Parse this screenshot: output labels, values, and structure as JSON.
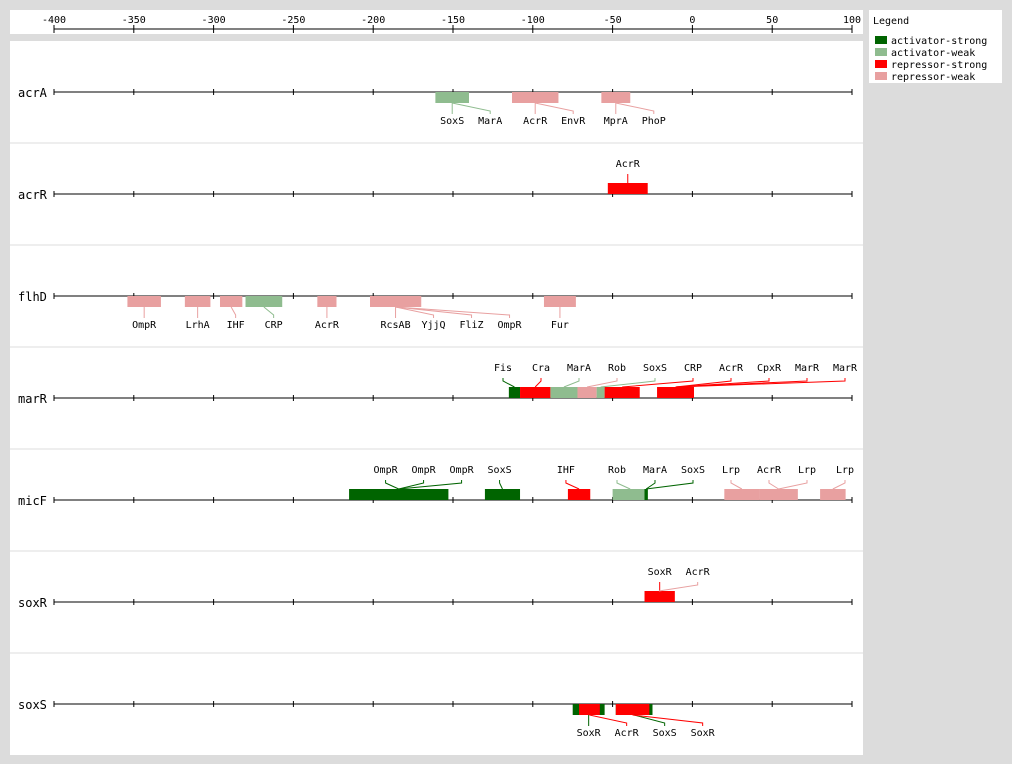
{
  "colors": {
    "activator-strong": "#006400",
    "activator-weak": "#8fbc8f",
    "repressor-strong": "#ff0000",
    "repressor-weak": "#e8a0a0"
  },
  "axis": {
    "min": -400,
    "max": 100,
    "ticks": [
      "-400",
      "-350",
      "-300",
      "-250",
      "-200",
      "-150",
      "-100",
      "-50",
      "0",
      "50",
      "100"
    ]
  },
  "legend": {
    "title": "Legend",
    "items": [
      {
        "key": "activator-strong",
        "label": "activator-strong"
      },
      {
        "key": "activator-weak",
        "label": "activator-weak"
      },
      {
        "key": "repressor-strong",
        "label": "repressor-strong"
      },
      {
        "key": "repressor-weak",
        "label": "repressor-weak"
      }
    ]
  },
  "chart_data": {
    "type": "diagram",
    "genes": [
      {
        "name": "acrA",
        "label_side": "below",
        "sites": [
          {
            "tf": "SoxS",
            "start": -161,
            "end": -140,
            "type": "activator-weak"
          },
          {
            "tf": "MarA",
            "start": -161,
            "end": -140,
            "type": "activator-weak"
          },
          {
            "tf": "AcrR",
            "start": -113,
            "end": -84,
            "type": "repressor-weak"
          },
          {
            "tf": "EnvR",
            "start": -113,
            "end": -84,
            "type": "repressor-weak"
          },
          {
            "tf": "MprA",
            "start": -57,
            "end": -39,
            "type": "repressor-weak"
          },
          {
            "tf": "PhoP",
            "start": -57,
            "end": -39,
            "type": "repressor-weak"
          }
        ]
      },
      {
        "name": "acrR",
        "label_side": "above",
        "sites": [
          {
            "tf": "AcrR",
            "start": -53,
            "end": -28,
            "type": "repressor-strong"
          }
        ]
      },
      {
        "name": "flhD",
        "label_side": "below",
        "sites": [
          {
            "tf": "OmpR",
            "start": -354,
            "end": -333,
            "type": "repressor-weak"
          },
          {
            "tf": "LrhA",
            "start": -318,
            "end": -302,
            "type": "repressor-weak"
          },
          {
            "tf": "IHF",
            "start": -296,
            "end": -282,
            "type": "repressor-weak"
          },
          {
            "tf": "CRP",
            "start": -280,
            "end": -257,
            "type": "activator-weak"
          },
          {
            "tf": "AcrR",
            "start": -235,
            "end": -223,
            "type": "repressor-weak"
          },
          {
            "tf": "RcsAB",
            "start": -202,
            "end": -170,
            "type": "repressor-weak"
          },
          {
            "tf": "YjjQ",
            "start": -202,
            "end": -170,
            "type": "repressor-weak"
          },
          {
            "tf": "FliZ",
            "start": -202,
            "end": -170,
            "type": "repressor-weak"
          },
          {
            "tf": "OmpR",
            "start": -202,
            "end": -170,
            "type": "repressor-weak"
          },
          {
            "tf": "Fur",
            "start": -93,
            "end": -73,
            "type": "repressor-weak"
          }
        ]
      },
      {
        "name": "marR",
        "label_side": "above",
        "sites": [
          {
            "tf": "Fis",
            "start": -115,
            "end": -108,
            "type": "activator-strong"
          },
          {
            "tf": "Cra",
            "start": -108,
            "end": -89,
            "type": "repressor-strong"
          },
          {
            "tf": "MarA",
            "start": -89,
            "end": -72,
            "type": "activator-weak"
          },
          {
            "tf": "Rob",
            "start": -72,
            "end": -60,
            "type": "repressor-weak"
          },
          {
            "tf": "SoxS",
            "start": -60,
            "end": -55,
            "type": "activator-weak"
          },
          {
            "tf": "CRP",
            "start": -55,
            "end": -33,
            "type": "repressor-strong"
          },
          {
            "tf": "AcrR",
            "start": -22,
            "end": 1,
            "type": "repressor-strong"
          },
          {
            "tf": "CpxR",
            "start": -22,
            "end": 1,
            "type": "repressor-strong"
          },
          {
            "tf": "MarR",
            "start": -22,
            "end": 1,
            "type": "repressor-strong"
          },
          {
            "tf": "MarR",
            "start": -22,
            "end": 1,
            "type": "repressor-strong"
          }
        ]
      },
      {
        "name": "micF",
        "label_side": "above",
        "sites": [
          {
            "tf": "OmpR",
            "start": -215,
            "end": -153,
            "type": "activator-strong"
          },
          {
            "tf": "OmpR",
            "start": -215,
            "end": -153,
            "type": "activator-strong"
          },
          {
            "tf": "OmpR",
            "start": -215,
            "end": -153,
            "type": "activator-strong"
          },
          {
            "tf": "SoxS",
            "start": -130,
            "end": -108,
            "type": "activator-strong"
          },
          {
            "tf": "IHF",
            "start": -78,
            "end": -64,
            "type": "repressor-strong"
          },
          {
            "tf": "Rob",
            "start": -50,
            "end": -28,
            "type": "activator-weak"
          },
          {
            "tf": "MarA",
            "start": -30,
            "end": -28,
            "type": "activator-strong"
          },
          {
            "tf": "SoxS",
            "start": -30,
            "end": -28,
            "type": "activator-strong"
          },
          {
            "tf": "Lrp",
            "start": 20,
            "end": 42,
            "type": "repressor-weak"
          },
          {
            "tf": "AcrR",
            "start": 42,
            "end": 66,
            "type": "repressor-weak"
          },
          {
            "tf": "Lrp",
            "start": 42,
            "end": 66,
            "type": "repressor-weak"
          },
          {
            "tf": "Lrp",
            "start": 80,
            "end": 96,
            "type": "repressor-weak"
          }
        ]
      },
      {
        "name": "soxR",
        "label_side": "above",
        "sites": [
          {
            "tf": "SoxR",
            "start": -30,
            "end": -11,
            "type": "repressor-strong"
          },
          {
            "tf": "AcrR",
            "start": -27,
            "end": -15,
            "type": "repressor-weak"
          }
        ]
      },
      {
        "name": "soxS",
        "label_side": "below",
        "sites": [
          {
            "tf": "SoxR",
            "start": -75,
            "end": -55,
            "type": "activator-strong"
          },
          {
            "tf": "AcrR",
            "start": -71,
            "end": -58,
            "type": "repressor-strong"
          },
          {
            "tf": "SoxS",
            "start": -48,
            "end": -25,
            "type": "activator-strong"
          },
          {
            "tf": "SoxR",
            "start": -48,
            "end": -27,
            "type": "repressor-strong"
          }
        ]
      }
    ]
  }
}
